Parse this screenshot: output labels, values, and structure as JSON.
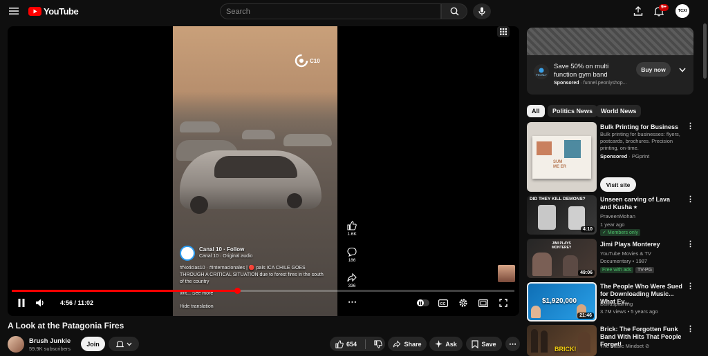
{
  "header": {
    "logo_text": "YouTube",
    "search_placeholder": "Search",
    "notifications_badge": "9+",
    "avatar_text": "TCXI"
  },
  "player": {
    "overlay": {
      "watermark": "C10",
      "channel": "Canal 10",
      "follow": "Follow",
      "audio": "Canal 10 · Original audio",
      "caption": "#Noticias10 · #Internacionales | 🔴 país ICA CHILE GOES THROUGH A CRITICAL SITUATION due to forest fires in the south of the country",
      "see_more": "Wit... See more",
      "hide_translation": "Hide translation",
      "likes": "1.6K",
      "comments": "186",
      "shares": "336"
    },
    "time": "4:56 / 11:02",
    "progress": 0.448
  },
  "video": {
    "title": "A Look at the Patagonia Fires",
    "channel": "Brush Junkie",
    "subscribers": "59.9K subscribers",
    "join": "Join",
    "likes": "654",
    "share": "Share",
    "ask": "Ask",
    "save": "Save"
  },
  "ad": {
    "title": "Save 50% on multi function gym band",
    "sponsored": "Sponsored",
    "url": "funnel.peonlyshop...",
    "button": "Buy now",
    "logo_text": "PEONLY"
  },
  "chips": [
    "All",
    "Politics News",
    "World News"
  ],
  "sponsored_card": {
    "title": "Bulk Printing for Business",
    "desc": "Bulk printing for businesses: flyers, postcards, brochures. Precision printing, on-time.",
    "sponsored": "Sponsored",
    "advertiser": "PGprint",
    "button": "Visit site",
    "thumb_text": "SUM ME ER"
  },
  "recs": [
    {
      "title": "Unseen carving of Lava and Kusha ⭑",
      "channel": "PraveenMohan",
      "meta": "1 year ago",
      "badge": "Members only",
      "duration": "4:10",
      "thumb_text": "DID THEY KILL DEMONS?"
    },
    {
      "title": "Jimi Plays Monterey",
      "channel": "YouTube Movies & TV",
      "meta": "Documentary • 1987",
      "badge": "Free with ads",
      "badge2": "TV-PG",
      "duration": "49:06",
      "thumb_text": "JIMI PLAYS MONTEREY"
    },
    {
      "title": "The People Who Were Sued for Downloading Music... What Ev...",
      "channel": "Bandsplaining",
      "meta": "3.7M views • 5 years ago",
      "duration": "21:46",
      "thumb_text": "$1,920,000"
    },
    {
      "title": "Brick: The Forgotten Funk Band With Hits That People Forget!",
      "channel": "The Music Mindset ⊘",
      "meta": "",
      "thumb_text": "BRICK!"
    }
  ],
  "colors": {
    "accent": "#ff0000",
    "bg": "#0f0f0f",
    "chip": "#272727"
  }
}
